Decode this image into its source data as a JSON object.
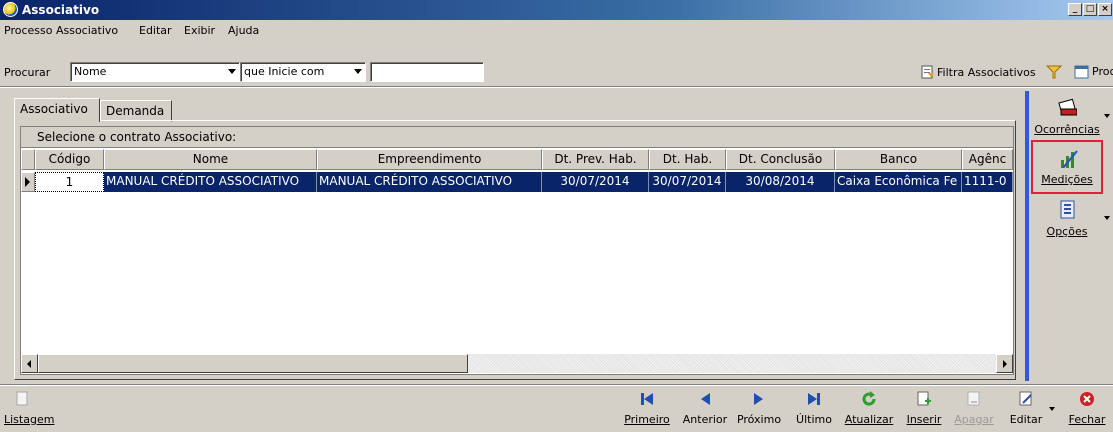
{
  "window": {
    "title": "Associativo",
    "controls": [
      "_",
      "□",
      "×"
    ]
  },
  "menu": [
    "Processo Associativo",
    "Editar",
    "Exibir",
    "Ajuda"
  ],
  "search": {
    "label": "Procurar",
    "field_value": "Nome",
    "mode_value": "que Inicie com",
    "text_value": "",
    "filter_label": "Filtra Associativos",
    "search_label": "Procurar"
  },
  "tabs": [
    {
      "label": "Associativo",
      "active": true
    },
    {
      "label": "Demanda",
      "active": false
    }
  ],
  "grid": {
    "group_text": "Selecione o contrato Associativo:",
    "columns": [
      "Código",
      "Nome",
      "Empreendimento",
      "Dt. Prev. Hab.",
      "Dt. Hab.",
      "Dt. Conclusão",
      "Banco",
      "Agênc"
    ],
    "rows": [
      {
        "codigo": "1",
        "nome": "MANUAL CRÉDITO ASSOCIATIVO",
        "empreendimento": "MANUAL CRÉDITO ASSOCIATIVO",
        "dt_prev_hab": "30/07/2014",
        "dt_hab": "30/07/2014",
        "dt_conclusao": "30/08/2014",
        "banco": "Caixa Econômica Fe",
        "agencia": "1111-0"
      }
    ]
  },
  "side_actions": [
    {
      "label": "Ocorrências",
      "icon": "ocorrencias-icon"
    },
    {
      "label": "Medições",
      "icon": "medicoes-icon",
      "highlighted": true
    },
    {
      "label": "Opções",
      "icon": "opcoes-icon"
    }
  ],
  "toolbar": {
    "listagem": "Listagem",
    "primeiro": "Primeiro",
    "anterior": "Anterior",
    "proximo": "Próximo",
    "ultimo": "Último",
    "atualizar": "Atualizar",
    "inserir": "Inserir",
    "apagar": "Apagar",
    "editar": "Editar",
    "fechar": "Fechar"
  },
  "colors": {
    "title_bar": "#0a246a",
    "selection": "#0a246a",
    "accent_bar": "#2f5bd6",
    "highlight_border": "#e0203a"
  }
}
